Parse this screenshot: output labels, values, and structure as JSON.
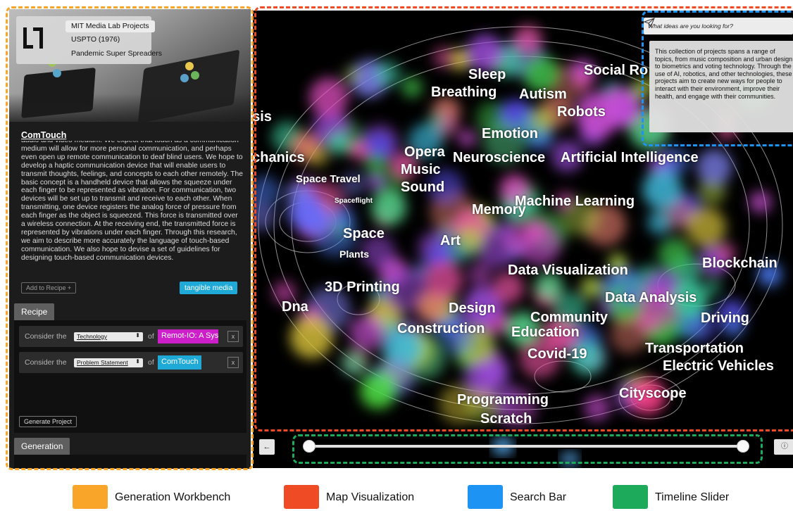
{
  "workbench": {
    "sources": [
      "MIT Media Lab Projects",
      "USPTO (1976)",
      "Pandemic Super Spreaders"
    ],
    "project": {
      "title": "ComTouch",
      "description": "audio and video medium. We expect that touch as a communication medium will allow for more personal communication, and perhaps even open up remote communication to deaf blind users. We hope to develop a haptic communication device that will enable users to transmit thoughts, feelings, and concepts to each other remotely. The basic concept is a handheld device that allows the squeeze under each finger to be represented as vibration. For communication, two devices will be set up to transmit and receive to each other. When transmitting, one device registers the analog force of pressure from each finger as the object is squeezed. This force is transmitted over a wireless connection. At the receiving end, the transmitted force is represented by vibrations under each finger. Through this research, we aim to describe more accurately the language of touch-based communication. We also hope to devise a set of guidelines for designing touch-based communication devices.",
      "add_button": "Add to Recipe +",
      "tag": "tangible media"
    },
    "recipe": {
      "tab": "Recipe",
      "rows": [
        {
          "prefix": "Consider the",
          "select": "Technology",
          "of": "of",
          "chip": "Remot-IO: A Sys",
          "chip_color": "#cc1ec9",
          "remove": "x"
        },
        {
          "prefix": "Consider the",
          "select": "Problem Statement",
          "of": "of",
          "chip": "ComTouch",
          "chip_color": "#1ea9d6",
          "remove": "x"
        }
      ],
      "generate_button": "Generate Project"
    },
    "generation": {
      "tab": "Generation"
    }
  },
  "map": {
    "labels": [
      {
        "text": "Sleep",
        "size": 20
      },
      {
        "text": "Breathing",
        "size": 20
      },
      {
        "text": "Social Ro",
        "size": 20
      },
      {
        "text": "Autism",
        "size": 20
      },
      {
        "text": "Robots",
        "size": 20
      },
      {
        "text": "esis",
        "size": 20
      },
      {
        "text": "Emotion",
        "size": 20
      },
      {
        "text": "echanics",
        "size": 20
      },
      {
        "text": "Opera",
        "size": 20
      },
      {
        "text": "Neuroscience",
        "size": 20
      },
      {
        "text": "Artificial Intelligence",
        "size": 20
      },
      {
        "text": "Music",
        "size": 20
      },
      {
        "text": "Space Travel",
        "size": 15
      },
      {
        "text": "Sound",
        "size": 20
      },
      {
        "text": "Spaceflight",
        "size": 10
      },
      {
        "text": "Memory",
        "size": 20
      },
      {
        "text": "Machine Learning",
        "size": 20
      },
      {
        "text": "Space",
        "size": 20
      },
      {
        "text": "Art",
        "size": 20
      },
      {
        "text": "Plants",
        "size": 14
      },
      {
        "text": "Data Visualization",
        "size": 20
      },
      {
        "text": "Blockchain",
        "size": 20
      },
      {
        "text": "3D Printing",
        "size": 20
      },
      {
        "text": "Data Analysis",
        "size": 20
      },
      {
        "text": "Dna",
        "size": 20
      },
      {
        "text": "Design",
        "size": 20
      },
      {
        "text": "Community",
        "size": 20
      },
      {
        "text": "Driving",
        "size": 20
      },
      {
        "text": "Construction",
        "size": 20
      },
      {
        "text": "Education",
        "size": 20
      },
      {
        "text": "Covid-19",
        "size": 20
      },
      {
        "text": "Transportation",
        "size": 20
      },
      {
        "text": "Electric Vehicles",
        "size": 20
      },
      {
        "text": "Cityscope",
        "size": 20
      },
      {
        "text": "Programming",
        "size": 20
      },
      {
        "text": "Scratch",
        "size": 20
      }
    ],
    "search": {
      "placeholder": "What ideas are you looking for?",
      "result": "This collection of projects spans a range of topics, from music composition and urban design to biometrics and voting technology. Through the use of AI, robotics, and other technologies, these projects aim to create new ways for people to interact with their environment, improve their health, and engage with their communities."
    }
  },
  "timeline": {
    "back_symbol": "←",
    "info_symbol": "ⓘ",
    "range_start": 0,
    "range_end": 1
  },
  "legend": [
    {
      "label": "Generation Workbench",
      "color": "#f9a529"
    },
    {
      "label": "Map Visualization",
      "color": "#ef4b24"
    },
    {
      "label": "Search Bar",
      "color": "#1d93f3"
    },
    {
      "label": "Timeline Slider",
      "color": "#1daa5a"
    }
  ]
}
